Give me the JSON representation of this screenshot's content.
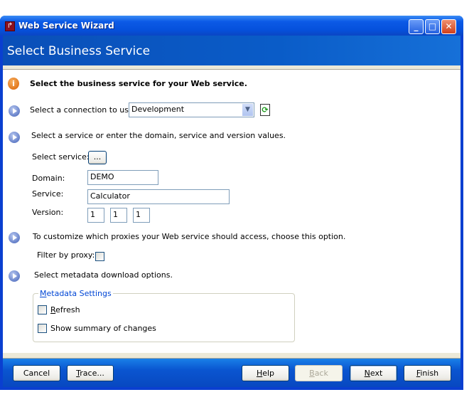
{
  "window": {
    "title": "Web Service Wizard",
    "icon": "app-icon",
    "controls": [
      "minimize-icon",
      "maximize-icon",
      "close-icon"
    ]
  },
  "banner": {
    "title": "Select Business Service"
  },
  "intro": "Select the business service for your Web service.",
  "connection": {
    "label": "Select a connection to use.",
    "value": "Development"
  },
  "service_section": {
    "label": "Select a service or enter the domain, service and version values.",
    "select_service_label": "Select service:",
    "browse_label": "...",
    "domain_label": "Domain:",
    "domain_value": "DEMO",
    "service_label": "Service:",
    "service_value": "Calculator",
    "version_label": "Version:",
    "version_values": [
      "1",
      "1",
      "1"
    ]
  },
  "proxy_section": {
    "label": "To customize which proxies your Web service should access, choose this option.",
    "filter_label": "Filter by proxy:",
    "filter_checked": false
  },
  "metadata_section": {
    "label": "Select metadata download options.",
    "group_label": "Metadata Settings",
    "refresh_label": "Refresh",
    "refresh_checked": false,
    "summary_label": "Show summary of changes",
    "summary_checked": false
  },
  "buttons": {
    "cancel": "Cancel",
    "trace": "Trace...",
    "help": "Help",
    "back": "Back",
    "next": "Next",
    "finish": "Finish"
  }
}
